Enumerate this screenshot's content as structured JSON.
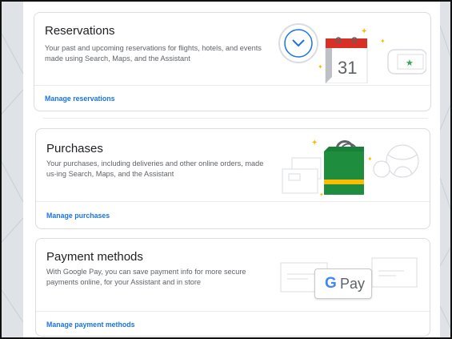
{
  "reservations": {
    "title": "Reservations",
    "description": "Your past and upcoming reservations for flights, hotels, and events made using Search, Maps, and the Assistant",
    "link": "Manage reservations",
    "calendar_day": "31"
  },
  "purchases": {
    "title": "Purchases",
    "description": "Your purchases, including deliveries and other online orders, made us-ing Search, Maps, and the Assistant",
    "link": "Manage purchases"
  },
  "payment_methods": {
    "title": "Payment methods",
    "description": "With Google Pay, you can save payment info for more secure payments online, for your Assistant and in store",
    "link": "Manage payment methods",
    "gpay_g": "G",
    "gpay_pay": "Pay"
  },
  "colors": {
    "link": "#1a73e8",
    "calendar_red": "#d93025",
    "bag_green": "#1e8e3e",
    "accent_yellow": "#fbbc04",
    "star_green": "#34a853"
  },
  "icons": [
    "clock-icon",
    "calendar-icon",
    "ticket-icon",
    "sparkle-icon",
    "shopping-bag-icon",
    "box-icon",
    "ball-icon",
    "card-icon"
  ]
}
